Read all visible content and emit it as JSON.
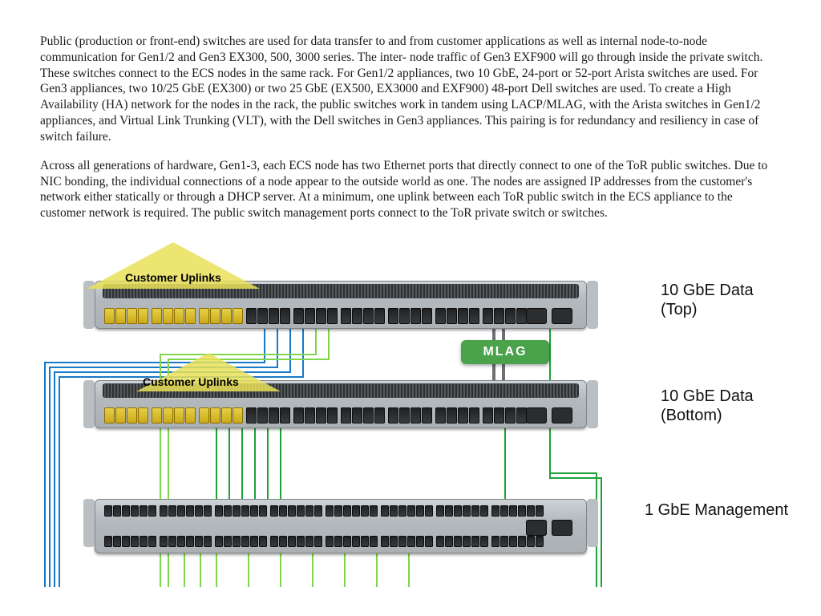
{
  "paragraphs": {
    "p1": "Public (production or front-end) switches are used for data transfer to and from customer applications as well as internal node-to-node communication for Gen1/2 and Gen3 EX300, 500, 3000 series. The inter- node traffic of Gen3 EXF900 will go through inside the private switch. These switches connect to the ECS nodes in the same rack. For Gen1/2 appliances, two 10 GbE, 24-port or 52-port Arista switches are used. For Gen3 appliances, two 10/25 GbE (EX300) or two 25 GbE (EX500, EX3000 and EXF900) 48-port Dell switches are used. To create a High Availability (HA) network for the nodes in the rack, the public switches work in tandem using LACP/MLAG, with the Arista switches in Gen1/2 appliances, and Virtual Link Trunking (VLT), with the Dell switches in Gen3 appliances. This pairing is for redundancy and resiliency in case of switch failure.",
    "p2": "Across all generations of hardware, Gen1-3, each ECS node has two Ethernet ports that directly connect to one of the ToR public switches. Due to NIC bonding, the individual connections of a node appear to the outside world as one. The nodes are assigned IP addresses from the customer's network either statically or through a DHCP server. At a minimum, one uplink between each ToR public switch in the ECS appliance to the customer network is required. The public switch management ports connect to the ToR private switch or switches."
  },
  "diagram": {
    "uplinks_label": "Customer Uplinks",
    "mlag_label": "MLAG",
    "labels": {
      "top": "10 GbE Data (Top)",
      "bottom": "10 GbE Data (Bottom)",
      "mgmt": "1 GbE Management"
    },
    "arrow_color": "#e9e159"
  }
}
